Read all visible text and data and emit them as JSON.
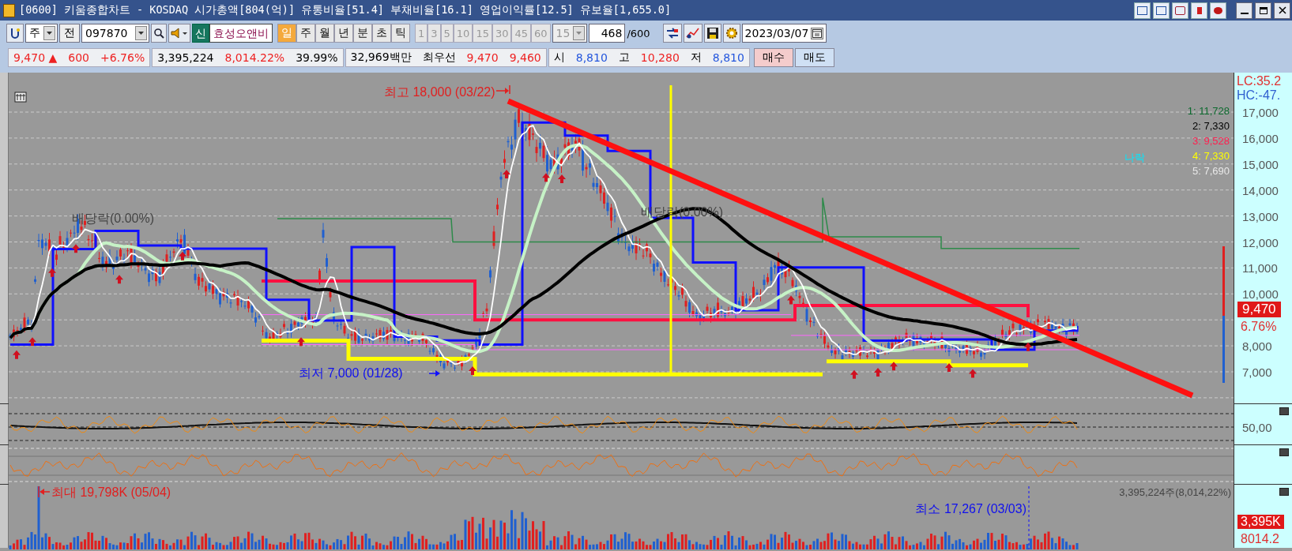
{
  "window": {
    "title": "[0600] 키움종합차트 - KOSDAQ 시가총액[804(억)] 유통비율[51.4] 부채비율[16.1] 영업이익률[12.5] 유보율[1,655.0]"
  },
  "toolbar": {
    "market": "주",
    "prev_button": "전",
    "code": "097870",
    "badge": "신",
    "stock_name": "효성오앤비",
    "periods": [
      {
        "label": "일",
        "selected": true
      },
      {
        "label": "주",
        "selected": false
      },
      {
        "label": "월",
        "selected": false
      },
      {
        "label": "년",
        "selected": false
      },
      {
        "label": "분",
        "selected": false
      },
      {
        "label": "초",
        "selected": false
      },
      {
        "label": "틱",
        "selected": false
      }
    ],
    "intervals": [
      "1",
      "3",
      "5",
      "10",
      "15",
      "30",
      "45",
      "60"
    ],
    "interval_select": "15",
    "count": "468",
    "count_max": "/600",
    "date": "2023/03/07"
  },
  "quote": {
    "groups": [
      [
        {
          "text": "9,470 ▲",
          "color": "#ee2222"
        },
        {
          "text": "600",
          "color": "#ee2222"
        },
        {
          "text": "+6.76%",
          "color": "#ee2222"
        }
      ],
      [
        {
          "text": "3,395,224"
        },
        {
          "text": "8,014.22%",
          "color": "#ee2222"
        },
        {
          "text": "39.99%"
        }
      ],
      [
        {
          "text": "32,969백만"
        },
        {
          "text": "최우선"
        },
        {
          "text": "9,470",
          "color": "#ee2222"
        },
        {
          "text": "9,460",
          "color": "#ee2222"
        }
      ],
      [
        {
          "text": "시"
        },
        {
          "text": "8,810",
          "color": "#2255dd"
        },
        {
          "text": "고"
        },
        {
          "text": "10,280",
          "color": "#ee2222"
        },
        {
          "text": "저"
        },
        {
          "text": "8,810",
          "color": "#2255dd"
        }
      ]
    ],
    "buy_button": "매수",
    "sell_button": "매도"
  },
  "chart": {
    "high_label": "최고 18,000 (03/22)",
    "low_label": "최저 7,000 (01/28)",
    "dividend_labels": [
      "배당락(0.00%)",
      "배당락(0.00%)"
    ],
    "legend": [
      {
        "text": "1: 11,728",
        "color": "#0c6a2e"
      },
      {
        "text": "2: 7,330",
        "color": "#000000"
      },
      {
        "text": "3: 9,528",
        "color": "#ff2050"
      },
      {
        "text": "4: 7,330",
        "color": "#ffff00"
      },
      {
        "text": "5: 7,690",
        "color": "#e8e8e8"
      }
    ],
    "legend_extra": "나락",
    "axis_header": [
      "LC:35.2",
      "HC:-47."
    ],
    "price_ticks": [
      "17,000",
      "16,000",
      "15,000",
      "14,000",
      "13,000",
      "12,000",
      "11,000",
      "10,000",
      "8,000",
      "7,000"
    ],
    "current_price": "9,470",
    "current_change": "6.76%",
    "oscillator_tick": "50,00",
    "volume_max_label": "최대 19,798K (05/04)",
    "volume_min_label": "최소 17,267 (03/03)",
    "volume_total": "3,395,224주(8,014,22%)",
    "volume_current": "3,395K",
    "volume_ratio": "8014.2"
  }
}
